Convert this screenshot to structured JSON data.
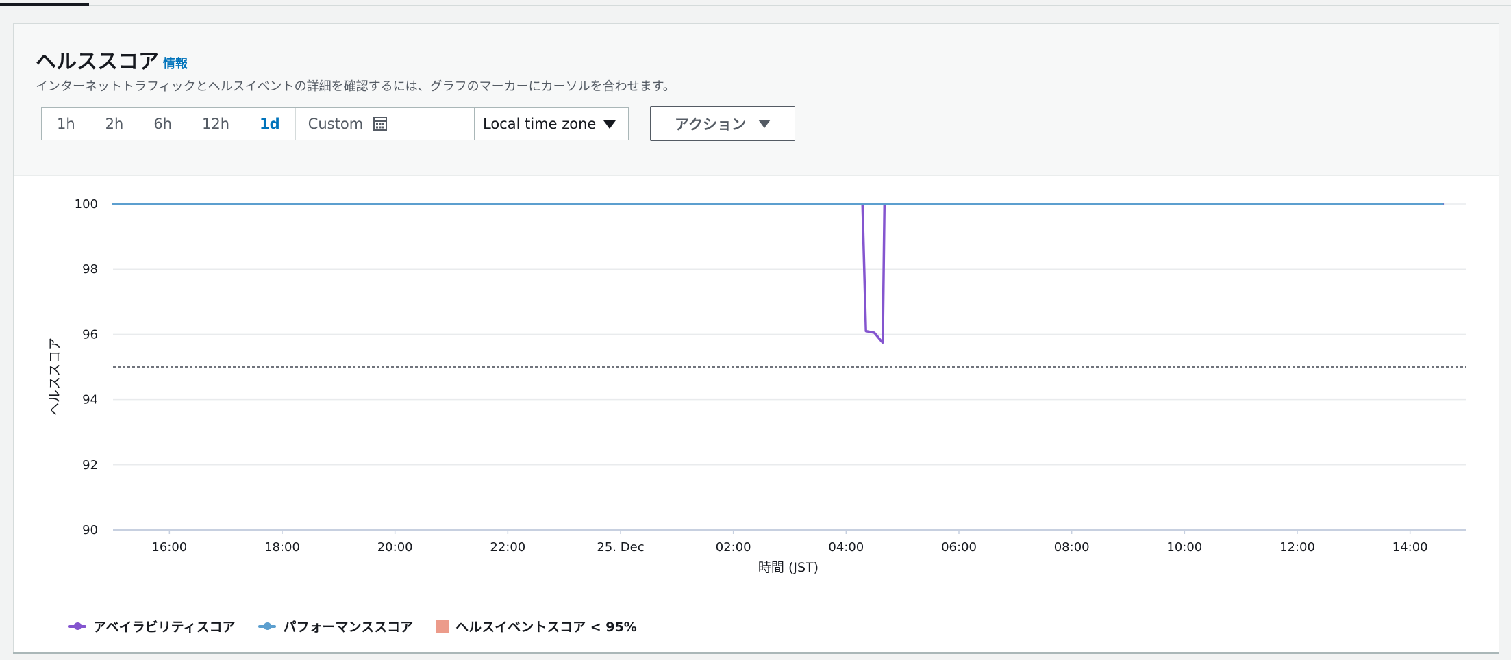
{
  "header": {
    "title": "ヘルススコア",
    "info_link": "情報",
    "description": "インターネットトラフィックとヘルスイベントの詳細を確認するには、グラフのマーカーにカーソルを合わせます。"
  },
  "time_range": {
    "options": [
      "1h",
      "2h",
      "6h",
      "12h",
      "1d"
    ],
    "selected": "1d",
    "custom_label": "Custom"
  },
  "timezone": {
    "selected": "Local time zone"
  },
  "actions": {
    "label": "アクション"
  },
  "colors": {
    "availability": "#8455cf",
    "performance": "#5c9fcf",
    "health_event": "#ec9b8a",
    "link": "#0073bb"
  },
  "chart_data": {
    "type": "line",
    "ylabel": "ヘルススコア",
    "xlabel": "時間 (JST)",
    "ylim": [
      90,
      100
    ],
    "yticks": [
      100,
      98,
      96,
      94,
      92,
      90
    ],
    "xlim_hours": [
      15.0,
      39.0
    ],
    "xticks": [
      {
        "h": 16,
        "label": "16:00"
      },
      {
        "h": 18,
        "label": "18:00"
      },
      {
        "h": 20,
        "label": "20:00"
      },
      {
        "h": 22,
        "label": "22:00"
      },
      {
        "h": 24,
        "label": "25. Dec"
      },
      {
        "h": 26,
        "label": "02:00"
      },
      {
        "h": 28,
        "label": "04:00"
      },
      {
        "h": 30,
        "label": "06:00"
      },
      {
        "h": 32,
        "label": "08:00"
      },
      {
        "h": 34,
        "label": "10:00"
      },
      {
        "h": 36,
        "label": "12:00"
      },
      {
        "h": 38,
        "label": "14:00"
      }
    ],
    "threshold": {
      "value": 95
    },
    "grid": true,
    "series": [
      {
        "name": "アベイラビリティスコア",
        "color": "#8455cf",
        "points": [
          [
            15.0,
            100
          ],
          [
            28.29,
            100
          ],
          [
            28.35,
            96.1
          ],
          [
            28.5,
            96.05
          ],
          [
            28.62,
            95.8
          ],
          [
            28.65,
            95.75
          ],
          [
            28.68,
            100
          ],
          [
            38.58,
            100
          ]
        ]
      },
      {
        "name": "パフォーマンススコア",
        "color": "#5c9fcf",
        "points": [
          [
            15.0,
            100
          ],
          [
            38.58,
            100
          ]
        ]
      }
    ],
    "legend": [
      {
        "name": "アベイラビリティスコア",
        "kind": "line-dot",
        "color": "#8455cf"
      },
      {
        "name": "パフォーマンススコア",
        "kind": "line-dot",
        "color": "#5c9fcf"
      },
      {
        "name": "ヘルスイベントスコア < 95%",
        "kind": "square",
        "color": "#ec9b8a"
      }
    ],
    "legend_position": "bottom-left"
  }
}
